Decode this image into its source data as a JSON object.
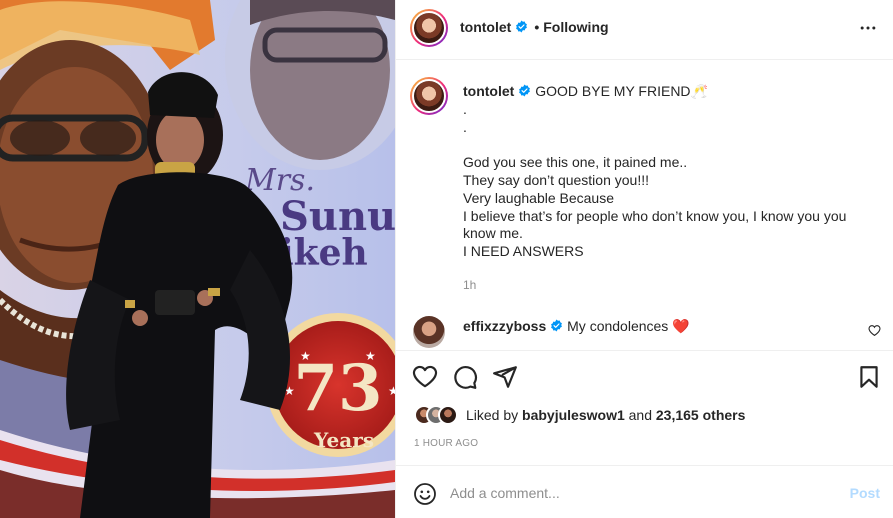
{
  "photo": {
    "banner_prefix": "Mrs.",
    "banner_name_line1": "Sunu",
    "banner_name_line2": "ikeh",
    "badge_number": "73",
    "badge_label": "Years"
  },
  "header": {
    "username": "tontolet",
    "separator": "•",
    "follow_status": "Following"
  },
  "caption": {
    "username": "tontolet",
    "lines": [
      "GOOD BYE MY FRIEND🥂",
      ".",
      ".",
      "",
      "God you see this one, it pained me..",
      "They say don’t question you!!!",
      "Very laughable Because",
      "I believe that’s for people who don’t know you, I know you you",
      "know me.",
      "I NEED ANSWERS"
    ],
    "time": "1h"
  },
  "comment": {
    "username": "effixzzyboss",
    "text": "My condolences ❤️"
  },
  "likes": {
    "prefix": "Liked by ",
    "user": "babyjuleswow1",
    "middle": " and ",
    "count": "23,165 others"
  },
  "timestamp": "1 HOUR AGO",
  "add_comment": {
    "placeholder": "Add a comment...",
    "post_label": "Post"
  },
  "colors": {
    "verified": "#0095f6",
    "heart": "#ed4956",
    "post_disabled": "#b3dbff",
    "muted": "#8e8e8e"
  },
  "icons": [
    "more-options-icon",
    "verified-icon",
    "heart-icon",
    "comment-icon",
    "share-icon",
    "bookmark-icon",
    "emoji-icon",
    "like-comment-icon"
  ]
}
